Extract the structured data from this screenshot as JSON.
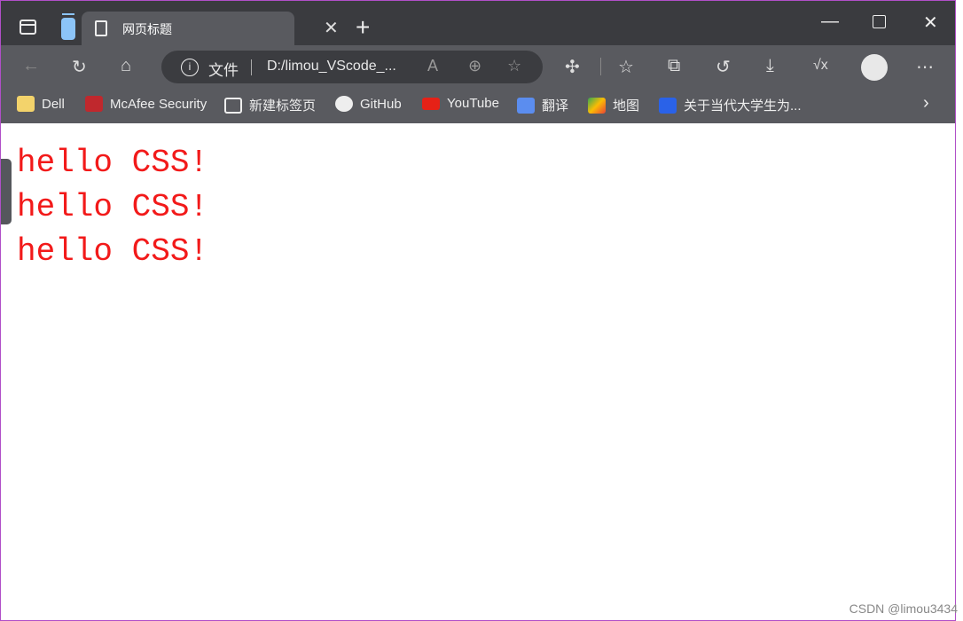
{
  "browser": {
    "tab_title": "网页标题",
    "address": {
      "scheme_label": "文件",
      "url": "D:/limou_VScode_..."
    },
    "bookmarks": [
      "Dell",
      "McAfee Security",
      "新建标签页",
      "GitHub",
      "YouTube",
      "翻译",
      "地图",
      "关于当代大学生为..."
    ]
  },
  "page": {
    "lines": [
      "hello CSS!",
      "hello CSS!",
      "hello CSS!"
    ],
    "text_color": "#f21a1a"
  },
  "watermark": "CSDN @limou3434"
}
